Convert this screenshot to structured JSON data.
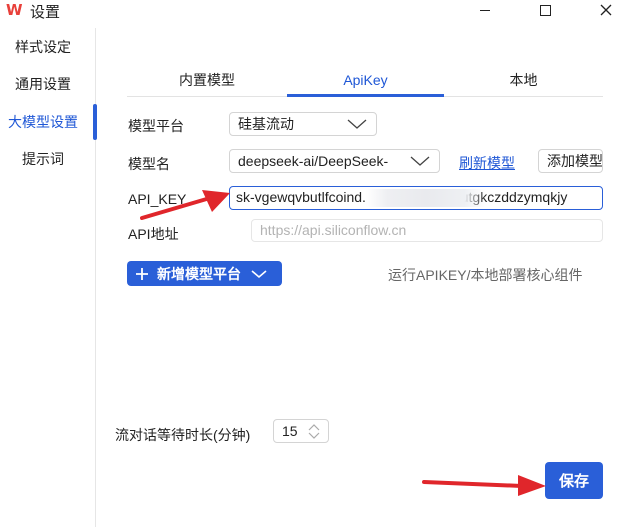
{
  "window": {
    "title": "设置",
    "logo": "W"
  },
  "sidebar": {
    "items": [
      {
        "label": "样式设定"
      },
      {
        "label": "通用设置"
      },
      {
        "label": "大模型设置"
      },
      {
        "label": "提示词"
      }
    ],
    "active_index": 2
  },
  "tabs": {
    "items": [
      {
        "label": "内置模型"
      },
      {
        "label": "ApiKey"
      },
      {
        "label": "本地"
      }
    ],
    "active_index": 1
  },
  "form": {
    "platform_label": "模型平台",
    "platform_value": "硅基流动",
    "model_label": "模型名",
    "model_value": "deepseek-ai/DeepSeek-",
    "refresh_link": "刷新模型",
    "add_model_button": "添加模型",
    "api_key_label": "API_KEY",
    "api_key_prefix": "sk-vgewqvbutlfcoind.",
    "api_key_suffix": "ozzsutgkczddzymqkjy",
    "api_url_label": "API地址",
    "api_url_placeholder": "https://api.siliconflow.cn",
    "add_platform_button": "新增模型平台",
    "hint": "运行APIKEY/本地部署核心组件",
    "wait_label": "流对话等待时长(分钟)",
    "wait_value": "15",
    "save_button": "保存"
  },
  "colors": {
    "accent": "#2a5fd8",
    "annotation_arrow": "#e0262b",
    "logo": "#e8403a"
  },
  "icons": {
    "logo": "wps-logo-icon",
    "dropdown": "chevron-down-icon",
    "add": "plus-icon",
    "annotation": "red-arrow-annotation"
  }
}
